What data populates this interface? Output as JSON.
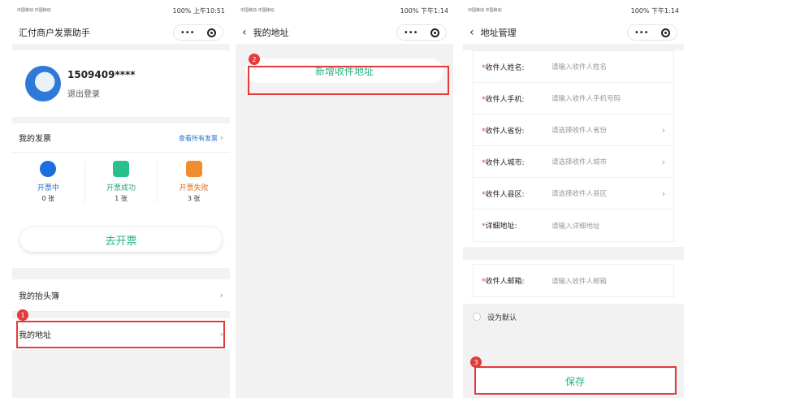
{
  "status": {
    "carrier": "中国移动\n中国移动",
    "battery": "100%",
    "time1": "上午10:51",
    "time2": "下午1:14",
    "time3": "下午1:14"
  },
  "capsule": {
    "more": "•••"
  },
  "screen1": {
    "title": "汇付商户发票助手",
    "user_name": "1509409****",
    "logout": "退出登录",
    "invoices_title": "我的发票",
    "view_all": "查看所有发票",
    "stats": [
      {
        "label": "开票中",
        "count": "0 张"
      },
      {
        "label": "开票成功",
        "count": "1 张"
      },
      {
        "label": "开票失败",
        "count": "3 张"
      }
    ],
    "invoice_button": "去开票",
    "title_book": "我的抬头簿",
    "my_address": "我的地址",
    "badge": "1"
  },
  "screen2": {
    "title": "我的地址",
    "add_address": "新增收件地址",
    "badge": "2"
  },
  "screen3": {
    "title": "地址管理",
    "fields": [
      {
        "label": "收件人姓名:",
        "placeholder": "请输入收件人姓名",
        "select": false
      },
      {
        "label": "收件人手机:",
        "placeholder": "请输入收件人手机号码",
        "select": false
      },
      {
        "label": "收件人省份:",
        "placeholder": "请选择收件人省份",
        "select": true
      },
      {
        "label": "收件人城市:",
        "placeholder": "请选择收件人城市",
        "select": true
      },
      {
        "label": "收件人县区:",
        "placeholder": "请选择收件人县区",
        "select": true
      },
      {
        "label": "详细地址:",
        "placeholder": "请输入详细地址",
        "select": false
      }
    ],
    "email_field": {
      "label": "收件人邮箱:",
      "placeholder": "请输入收件人邮箱"
    },
    "set_default": "设为默认",
    "save": "保存",
    "badge": "3"
  },
  "colors": {
    "accent_green": "#26b37e",
    "highlight_red": "#e23b3b",
    "link_blue": "#2a70c9"
  }
}
